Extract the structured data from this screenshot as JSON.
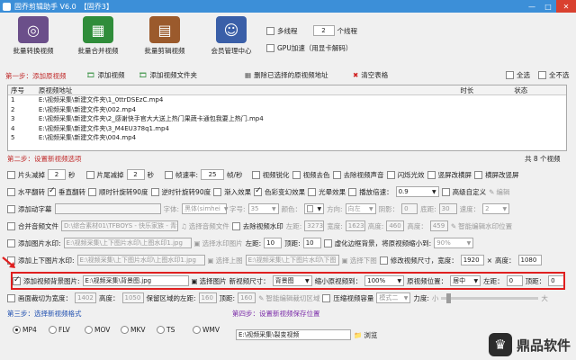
{
  "window": {
    "title": "固乔剪辑助手 V6.0",
    "badge": "【固乔3】"
  },
  "toolbar": {
    "items": [
      {
        "label": "批量转换视频",
        "icon": "film-reel-icon",
        "color": "#6b4f8a"
      },
      {
        "label": "批量合并视频",
        "icon": "merge-blocks-icon",
        "color": "#2f8d3a"
      },
      {
        "label": "批量剪辑视频",
        "icon": "film-strip-icon",
        "color": "#9b5a2c"
      },
      {
        "label": "会员管理中心",
        "icon": "member-avatar-icon",
        "color": "#3a5fa8"
      }
    ],
    "multithread_label": "多线程",
    "threads_value": "2",
    "threads_unit": "个线程",
    "gpu_label": "GPU加速（用显卡解码）"
  },
  "step1": {
    "label": "第一步：添加原视频",
    "add_video": "添加视频",
    "add_folder": "添加视频文件夹",
    "delete_selected": "删除已选择的原视频地址",
    "clear_table": "清空表格",
    "select_all": "全选",
    "deselect_all": "全不选"
  },
  "table": {
    "columns": [
      "序号",
      "原视频地址",
      "时长",
      "状态"
    ],
    "rows": [
      [
        "1",
        "E:\\视频采集\\新建文件夹\\1_0ttrDSEzC.mp4",
        "",
        ""
      ],
      [
        "2",
        "E:\\视频采集\\新建文件夹\\002.mp4",
        "",
        ""
      ],
      [
        "3",
        "E:\\视频采集\\新建文件夹\\2_感谢快手官大大送上热门果蔬卡通包我要上热门.mp4",
        "",
        ""
      ],
      [
        "4",
        "E:\\视频采集\\新建文件夹\\3_M4EU378q1.mp4",
        "",
        ""
      ],
      [
        "5",
        "E:\\视频采集\\新建文件夹\\004.mp4",
        "",
        ""
      ]
    ],
    "count": "共 8 个视频"
  },
  "step2": {
    "label": "第二步：设置新视频选项",
    "row1": {
      "head_cut": "片头减掉",
      "head_val": "2",
      "sec1": "秒",
      "tail_cut": "片尾减掉",
      "tail_val": "2",
      "sec2": "秒",
      "framerate": "帧速率:",
      "framerate_val": "25",
      "fps": "帧/秒",
      "sharpen": "视频锐化",
      "decolor": "视频去色",
      "remove_audio": "去除视频声音",
      "flash_effect": "闪烁光效",
      "portrait_to_landscape": "竖屏改横屏",
      "landscape_to_portrait": "横屏改竖屏"
    },
    "row2": {
      "hflip": "水平翻转",
      "vflip": "垂直翻转",
      "rot90cw": "顺时针旋转90度",
      "rot90ccw": "逆时针旋转90度",
      "fadein": "渐入效果",
      "color_effect": "色彩变幻效果",
      "light_effect": "光晕效果",
      "speed": "播放倍速：",
      "speed_val": "0.9",
      "advanced_custom": "高级自定义",
      "edit": "编辑"
    },
    "row3": {
      "add_subtitle": "添加动字幕",
      "font": "字体:",
      "font_val": "黑体(simhei",
      "size": "字号:",
      "size_val": "35",
      "color": "颜色：",
      "direction": "方向:",
      "direction_val": "向左",
      "shadow": "阴影：",
      "shadow_val": "0",
      "bottom": "底距:",
      "bottom_val": "30",
      "speed": "速度：",
      "speed_val": "2"
    },
    "row4": {
      "merge_audio": "合并音频文件",
      "audio_path": "D:\\综合素材01\\TFBOYS - 快乐家族 - 青春修炼手册.mp3",
      "select_audio": "选择音频文件",
      "remove_watermark": "去除视频水印",
      "left": "左距:",
      "left_val": "3273",
      "width": "宽度:",
      "width_val": "1623",
      "height": "高度:",
      "height_val": "460",
      "height2": "高度：",
      "height2_val": "459",
      "smart_wm": "智能编辑水印位置"
    },
    "row5": {
      "add_image_wm": "添加图片水印:",
      "wm_path": "E:\\视频采集\\上下图片水印\\上图水印1.jpg",
      "select_wm": "选择水印图片",
      "left": "左距:",
      "left_val": "10",
      "top": "顶距:",
      "top_val": "10",
      "virtual_border": "虚化边框背景，将原视频缩小到:",
      "scale_val": "90%"
    },
    "row6": {
      "add_topbottom": "添加上下图片水印:",
      "top_img": "E:\\视频采集\\上下图片水印\\上图水印1.jpg",
      "select_top": "选择上图",
      "bottom_img": "E:\\视频采集\\上下图片水印\\下图",
      "select_bottom": "选择下图",
      "resize": "修改视频尺寸，宽度：",
      "w_val": "1920",
      "x": "×",
      "h_label": "高度：",
      "h_val": "1080"
    },
    "row7": {
      "add_bg": "添加视频背景图片:",
      "bg_path": "E:\\视频采集\\背景图.jpg",
      "select_image": "选择图片",
      "new_size": "新视频尺寸：",
      "new_size_val": "背景图",
      "scale": "缩小原视频到：",
      "scale_val": "100%",
      "position": "原视频位置：",
      "position_val": "居中",
      "left": "左距：",
      "left_val": "0",
      "top": "顶距：",
      "top_val": "0"
    },
    "row8": {
      "crop": "画面裁切为宽度：",
      "crop_w": "1402",
      "height": "高度：",
      "crop_h": "1050",
      "keep_left": "保留区域的左距:",
      "keep_left_val": "160",
      "top": "顶距:",
      "top_val": "160",
      "smart_crop": "智能编辑裁切区域",
      "compress": "压缩视频容量",
      "mode_val": "模式二",
      "strength": "力度:",
      "small": "小",
      "big": "大"
    }
  },
  "step3": {
    "label": "第三步：选择新视频格式",
    "formats": [
      "MP4",
      "FLV",
      "MOV",
      "MKV",
      "TS",
      "WMV"
    ],
    "selected": "MP4"
  },
  "step4": {
    "label": "第四步：设置新视频保存位置",
    "path": "E:\\视频采集\\裂变视频",
    "browse": "浏览"
  },
  "watermark_logo": {
    "text": "鼎品软件"
  }
}
